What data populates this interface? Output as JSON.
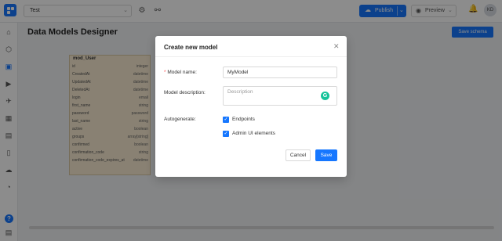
{
  "topbar": {
    "project_value": "Test",
    "publish_label": "Publish",
    "preview_label": "Preview",
    "avatar_initials": "KD"
  },
  "page": {
    "title": "Data Models Designer",
    "save_schema_label": "Save schema"
  },
  "model_card": {
    "title": "mod_User",
    "rows": [
      {
        "field": "id",
        "type": "integer"
      },
      {
        "field": "CreatedAt",
        "type": "datetime"
      },
      {
        "field": "UpdatedAt",
        "type": "datetime"
      },
      {
        "field": "DeletedAt",
        "type": "datetime"
      },
      {
        "field": "login",
        "type": "email"
      },
      {
        "field": "first_name",
        "type": "string"
      },
      {
        "field": "password",
        "type": "password"
      },
      {
        "field": "last_name",
        "type": "string"
      },
      {
        "field": "active",
        "type": "boolean"
      },
      {
        "field": "groups",
        "type": "array[string]"
      },
      {
        "field": "confirmed",
        "type": "boolean"
      },
      {
        "field": "confirmation_code",
        "type": "string"
      },
      {
        "field": "confirmation_code_expires_at",
        "type": "datetime"
      }
    ]
  },
  "modal": {
    "title": "Create new model",
    "name_label": "Model name:",
    "name_value": "MyModel",
    "description_label": "Model description:",
    "description_placeholder": "Description",
    "autogenerate_label": "Autogenerate:",
    "options": [
      {
        "label": "Endpoints",
        "checked": true
      },
      {
        "label": "Admin UI elements",
        "checked": true
      }
    ],
    "cancel_label": "Cancel",
    "save_label": "Save"
  },
  "colors": {
    "accent": "#1677ff",
    "card_bg": "#faecd2"
  }
}
